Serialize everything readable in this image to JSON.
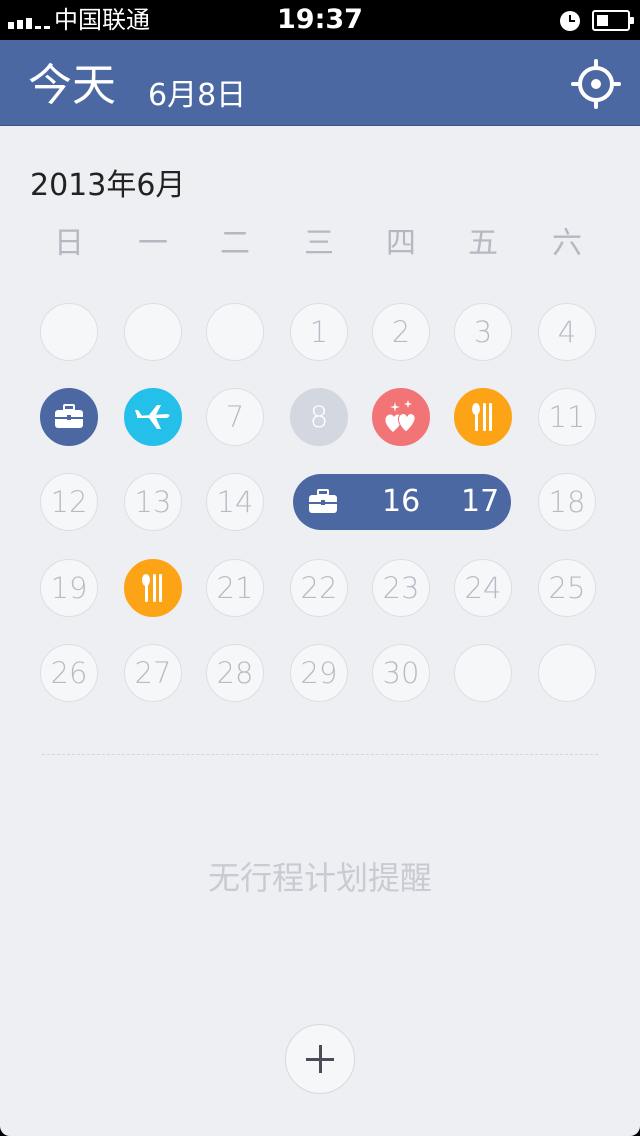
{
  "status_bar": {
    "carrier": "中国联通",
    "time": "19:37"
  },
  "header": {
    "title": "今天",
    "date": "6月8日"
  },
  "calendar": {
    "month_title": "2013年6月",
    "weekdays": [
      "日",
      "一",
      "二",
      "三",
      "四",
      "五",
      "六"
    ],
    "days": {
      "d1": "1",
      "d2": "2",
      "d3": "3",
      "d4": "4",
      "d7": "7",
      "d8": "8",
      "d11": "11",
      "d12": "12",
      "d13": "13",
      "d14": "14",
      "d16": "16",
      "d17": "17",
      "d18": "18",
      "d19": "19",
      "d21": "21",
      "d22": "22",
      "d23": "23",
      "d24": "24",
      "d25": "25",
      "d26": "26",
      "d27": "27",
      "d28": "28",
      "d29": "29",
      "d30": "30"
    },
    "event_icons": {
      "d5": "briefcase-icon",
      "d6": "airplane-icon",
      "d9": "hearts-icon",
      "d10": "dining-icon",
      "d15_17": "briefcase-icon",
      "d20": "dining-icon"
    }
  },
  "colors": {
    "header": "#4b68a3",
    "work": "#4b68a3",
    "travel": "#25c0ea",
    "love": "#f27477",
    "dining": "#fca415",
    "today": "#d3d7e0"
  },
  "schedule": {
    "empty_text": "无行程计划提醒"
  }
}
